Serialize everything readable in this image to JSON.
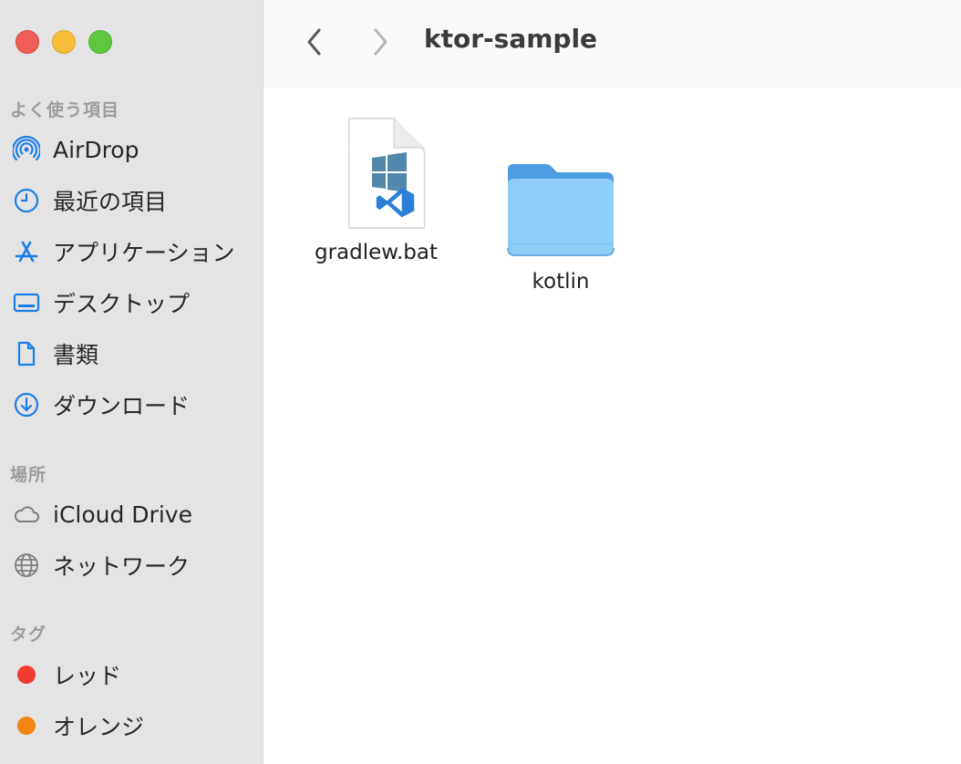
{
  "window": {
    "controls": [
      "close",
      "minimize",
      "zoom"
    ]
  },
  "sidebar": {
    "favorites_header": "よく使う項目",
    "favorites": [
      {
        "label": "AirDrop",
        "icon": "airdrop-icon"
      },
      {
        "label": "最近の項目",
        "icon": "clock-icon"
      },
      {
        "label": "アプリケーション",
        "icon": "applications-icon"
      },
      {
        "label": "デスクトップ",
        "icon": "desktop-icon"
      },
      {
        "label": "書類",
        "icon": "document-icon"
      },
      {
        "label": "ダウンロード",
        "icon": "download-icon"
      }
    ],
    "locations_header": "場所",
    "locations": [
      {
        "label": "iCloud Drive",
        "icon": "cloud-icon"
      },
      {
        "label": "ネットワーク",
        "icon": "globe-icon"
      }
    ],
    "tags_header": "タグ",
    "tags": [
      {
        "label": "レッド",
        "color": "#f23b30"
      },
      {
        "label": "オレンジ",
        "color": "#f18412"
      }
    ]
  },
  "toolbar": {
    "title": "ktor-sample",
    "back_icon": "chevron-left-icon",
    "forward_icon": "chevron-right-icon"
  },
  "files": [
    {
      "name": "gradlew.bat",
      "icon": "vscode-windows-file-icon"
    },
    {
      "name": "kotlin",
      "icon": "folder-icon"
    }
  ],
  "colors": {
    "accent": "#1a7ee8",
    "sidebar_bg": "#e4e4e4",
    "folder": "#6db8f2"
  }
}
